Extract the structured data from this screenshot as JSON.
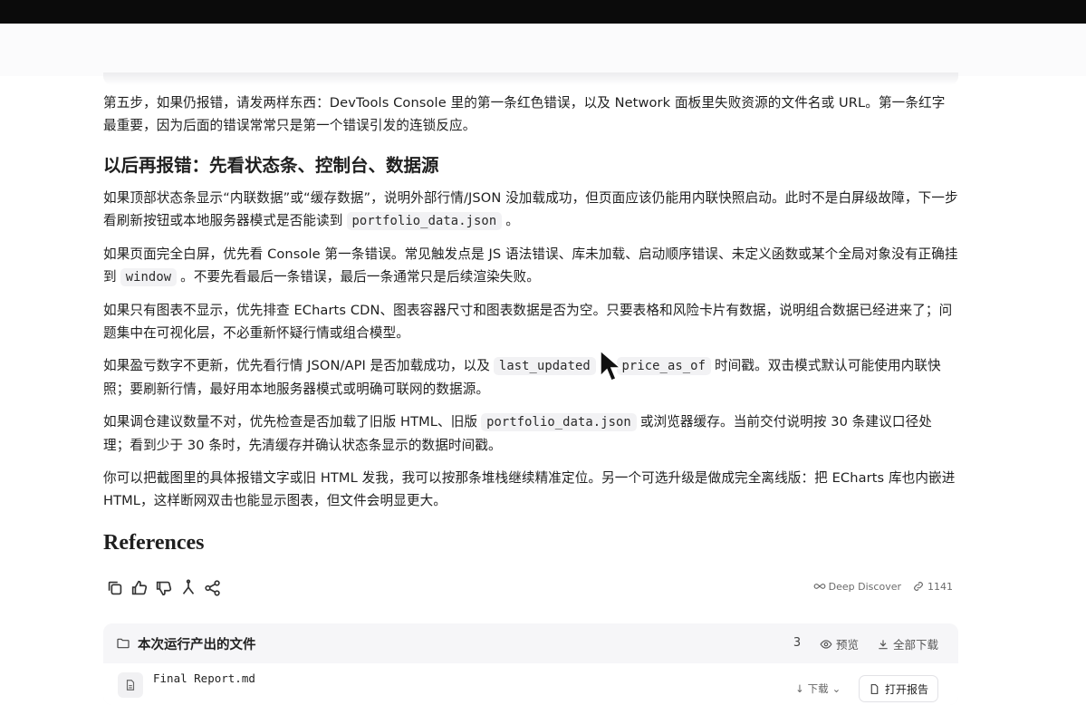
{
  "paragraphs": {
    "step5": "第五步，如果仍报错，请发两样东西：DevTools Console 里的第一条红色错误，以及 Network 面板里失败资源的文件名或 URL。第一条红字最重要，因为后面的错误常常只是第一个错误引发的连锁反应。",
    "heading2": "以后再报错：先看状态条、控制台、数据源",
    "p1_before": "如果顶部状态条显示“内联数据”或“缓存数据”，说明外部行情/JSON 没加载成功，但页面应该仍能用内联快照启动。此时不是白屏级故障，下一步看刷新按钮或本地服务器模式是否能读到",
    "p1_code": "portfolio_data.json",
    "p1_after": "。",
    "p2_before": "如果页面完全白屏，优先看 Console 第一条错误。常见触发点是 JS 语法错误、库未加载、启动顺序错误、未定义函数或某个全局对象没有正确挂到",
    "p2_code": "window",
    "p2_after": "。不要先看最后一条错误，最后一条通常只是后续渲染失败。",
    "p3": "如果只有图表不显示，优先排查 ECharts CDN、图表容器尺寸和图表数据是否为空。只要表格和风险卡片有数据，说明组合数据已经进来了；问题集中在可视化层，不必重新怀疑行情或组合模型。",
    "p4_before": "如果盈亏数字不更新，优先看行情 JSON/API 是否加载成功，以及",
    "p4_code1": "last_updated",
    "p4_mid": "、",
    "p4_code2": "price_as_of",
    "p4_after": "时间戳。双击模式默认可能使用内联快照；要刷新行情，最好用本地服务器模式或明确可联网的数据源。",
    "p5_before": "如果调仓建议数量不对，优先检查是否加载了旧版 HTML、旧版",
    "p5_code": "portfolio_data.json",
    "p5_after": "或浏览器缓存。当前交付说明按 30 条建议口径处理；看到少于 30 条时，先清缓存并确认状态条显示的数据时间戳。",
    "p6": "你可以把截图里的具体报错文字或旧 HTML 发我，我可以按那条堆栈继续精准定位。另一个可选升级是做成完全离线版：把 ECharts 库也内嵌进 HTML，这样断网双击也能显示图表，但文件会明显更大。",
    "references": "References"
  },
  "actions": {
    "copy": "copy-icon",
    "like": "thumbs-up-icon",
    "dislike": "thumbs-down-icon",
    "branch": "branch-icon",
    "share": "share-icon",
    "deep_discover": "Deep Discover",
    "link_count": "1141"
  },
  "files": {
    "title": "本次运行产出的文件",
    "count": "3",
    "preview": "预览",
    "download_all": "全部下载",
    "items": [
      {
        "name": "Final Report.md",
        "download": "下载",
        "open": "打开报告"
      }
    ]
  }
}
